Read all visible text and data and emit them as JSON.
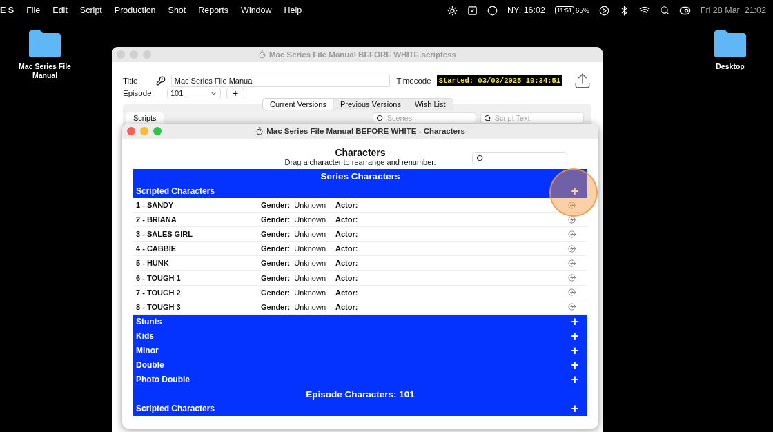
{
  "menu_bar": {
    "app": "E S",
    "items": [
      "File",
      "Edit",
      "Script",
      "Production",
      "Shot",
      "Reports",
      "Window",
      "Help"
    ],
    "clock_label": "NY: 16:02",
    "battery_time": "11:51",
    "battery_percent": "65%",
    "date": "Fri 28 Mar  21:02"
  },
  "desktop_icons": [
    {
      "label": "Mac Series File Manual"
    },
    {
      "label": "Desktop"
    }
  ],
  "main_window": {
    "title": "Mac Series File Manual  BEFORE WHITE.scriptess",
    "title_label": "Title",
    "title_value": "Mac Series File Manual",
    "timecode_label": "Timecode",
    "timecode": "Started: 03/03/2025 10:34:51",
    "episode_label": "Episode",
    "episode": "101",
    "add": "+",
    "tabs": [
      {
        "label": "Current Versions",
        "selected": true
      },
      {
        "label": "Previous Versions",
        "selected": false
      },
      {
        "label": "Wish List",
        "selected": false
      }
    ],
    "scripts_tab": "Scripts",
    "scenes_placeholder": "Scenes",
    "script_text_placeholder": "Script Text"
  },
  "characters_window": {
    "title": "Mac Series File Manual  BEFORE WHITE - Characters",
    "heading": "Characters",
    "subtitle": "Drag a character to rearrange and renumber.",
    "bands": [
      {
        "kind": "heading",
        "label": "Series Characters"
      },
      {
        "kind": "group",
        "label": "Scripted Characters",
        "add": "+",
        "characters": [
          {
            "name": "1 - SANDY",
            "gender_label": "Gender:",
            "gender": "Unknown",
            "actor_label": "Actor:"
          },
          {
            "name": "2 - BRIANA",
            "gender_label": "Gender:",
            "gender": "Unknown",
            "actor_label": "Actor:"
          },
          {
            "name": "3 - SALES GIRL",
            "gender_label": "Gender:",
            "gender": "Unknown",
            "actor_label": "Actor:"
          },
          {
            "name": "4 - CABBIE",
            "gender_label": "Gender:",
            "gender": "Unknown",
            "actor_label": "Actor:"
          },
          {
            "name": "5 - HUNK",
            "gender_label": "Gender:",
            "gender": "Unknown",
            "actor_label": "Actor:"
          },
          {
            "name": "6 - TOUGH 1",
            "gender_label": "Gender:",
            "gender": "Unknown",
            "actor_label": "Actor:"
          },
          {
            "name": "7 - TOUGH 2",
            "gender_label": "Gender:",
            "gender": "Unknown",
            "actor_label": "Actor:"
          },
          {
            "name": "8 - TOUGH 3",
            "gender_label": "Gender:",
            "gender": "Unknown",
            "actor_label": "Actor:"
          }
        ]
      },
      {
        "kind": "group",
        "label": "Stunts",
        "add": "+"
      },
      {
        "kind": "group",
        "label": "Kids",
        "add": "+"
      },
      {
        "kind": "group",
        "label": "Minor",
        "add": "+"
      },
      {
        "kind": "group",
        "label": "Double",
        "add": "+"
      },
      {
        "kind": "group",
        "label": "Photo Double",
        "add": "+"
      },
      {
        "kind": "heading",
        "label": "Episode Characters: 101"
      },
      {
        "kind": "group",
        "label": "Scripted Characters",
        "add": "+"
      }
    ]
  }
}
